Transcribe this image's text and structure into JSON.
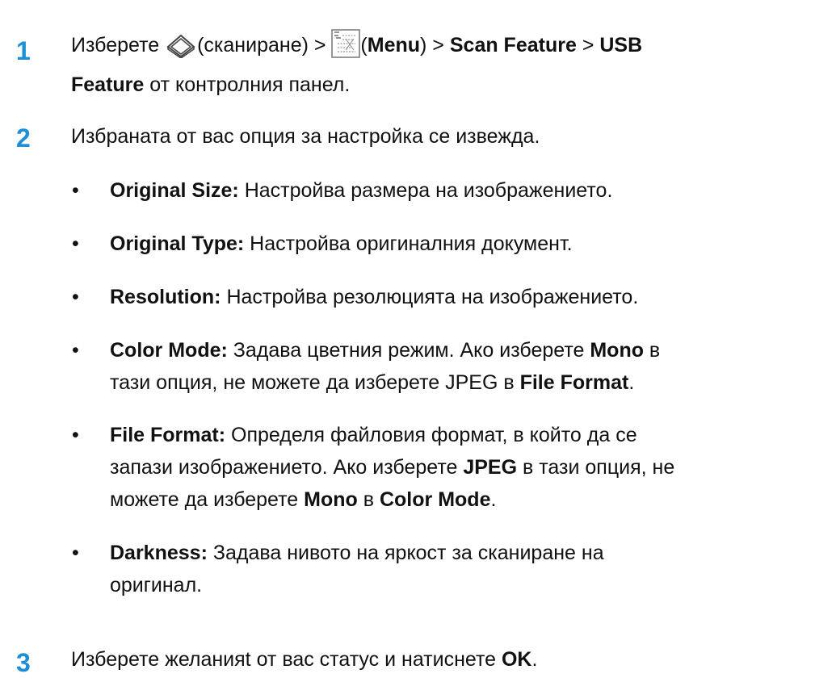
{
  "steps": [
    {
      "number": "1",
      "line1": {
        "t1": "Изберете ",
        "scan_label": "(сканиране) > ",
        "menu_open": "(",
        "menu_label": "Menu",
        "menu_close": ") > ",
        "scan_feature": "Scan Feature",
        "sep": " > ",
        "usb": "USB"
      },
      "line2": {
        "feature": "Feature",
        "rest": " от контролния панел."
      },
      "icons": [
        "scanner-icon",
        "menu-icon"
      ]
    },
    {
      "number": "2",
      "text": "Избраната от вас опция за настройка се извежда.",
      "bullets": [
        {
          "term": "Original Size:",
          "desc": " Настройва размера на изображението."
        },
        {
          "term": "Original Type:",
          "desc": " Настройва оригиналния документ."
        },
        {
          "term": "Resolution:",
          "desc": " Настройва резолюцията на изображението."
        },
        {
          "term": "Color Mode:",
          "desc1": " Задава цветния режим. Ако изберете ",
          "b1": "Mono",
          "desc2": " в",
          "desc3": "тази опция, не можете да изберете JPEG в ",
          "b2": "File Format",
          "desc4": "."
        },
        {
          "term": "File Format:",
          "desc1": " Определя файловия формат, в който да се",
          "desc2": "запази изображението. Ако изберете ",
          "b1": "JPEG",
          "desc3": " в тази опция, не",
          "desc4": "можете да изберете ",
          "b2": "Mono",
          "desc5": " в ",
          "b3": "Color Mode",
          "desc6": "."
        },
        {
          "term": "Darkness:",
          "desc1": " Задава нивото на яркост за сканиране на",
          "desc2": "оригинал."
        }
      ]
    },
    {
      "number": "3",
      "t1": "Изберете желанияt от вас статус и натиснете ",
      "ok": "OK",
      "t2": "."
    }
  ]
}
